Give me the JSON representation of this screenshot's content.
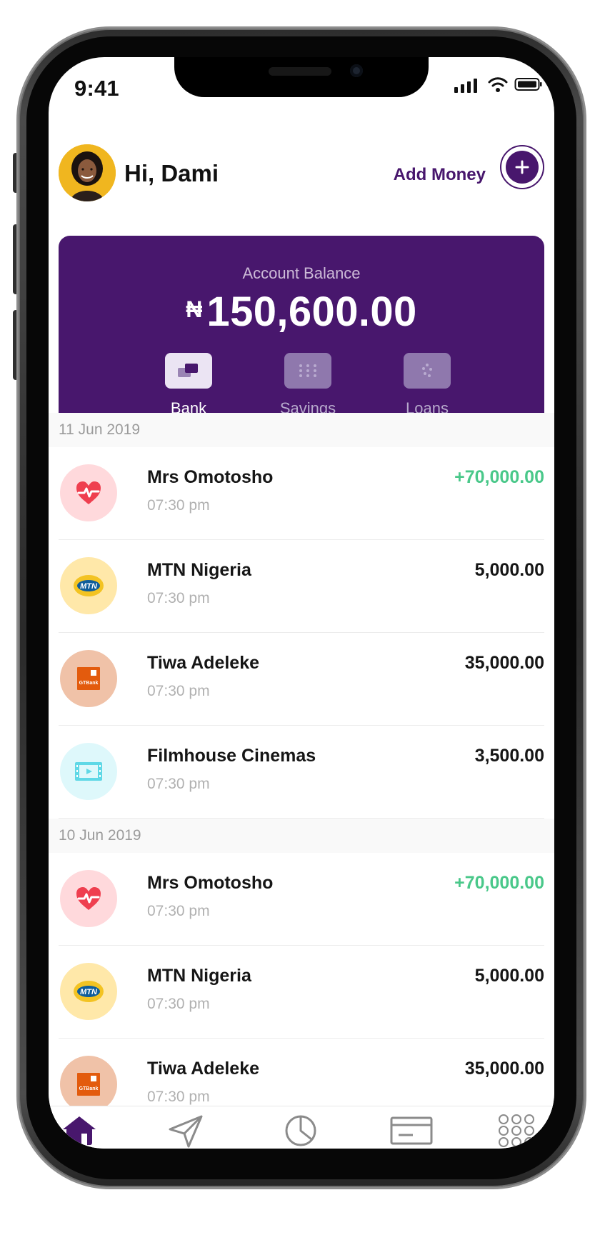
{
  "status_bar": {
    "time": "9:41"
  },
  "header": {
    "greeting": "Hi, Dami",
    "add_money_label": "Add Money"
  },
  "balance_card": {
    "label": "Account Balance",
    "currency": "₦",
    "amount": "150,600.00",
    "tabs": [
      {
        "label": "Bank",
        "icon": "bank-icon"
      },
      {
        "label": "Savings",
        "icon": "savings-icon"
      },
      {
        "label": "Loans",
        "icon": "loans-icon"
      }
    ]
  },
  "sections": [
    {
      "date": "11 Jun 2019",
      "transactions": [
        {
          "name": "Mrs Omotosho",
          "time": "07:30 pm",
          "amount": "+70,000.00",
          "icon": "heart-pulse-icon"
        },
        {
          "name": "MTN Nigeria",
          "time": "07:30 pm",
          "amount": "5,000.00",
          "icon": "mtn-logo-icon"
        },
        {
          "name": "Tiwa Adeleke",
          "time": "07:30 pm",
          "amount": "35,000.00",
          "icon": "gtbank-logo-icon"
        },
        {
          "name": "Filmhouse Cinemas",
          "time": "07:30 pm",
          "amount": "3,500.00",
          "icon": "film-icon"
        }
      ]
    },
    {
      "date": "10 Jun 2019",
      "transactions": [
        {
          "name": "Mrs Omotosho",
          "time": "07:30 pm",
          "amount": "+70,000.00",
          "icon": "heart-pulse-icon"
        },
        {
          "name": "MTN Nigeria",
          "time": "07:30 pm",
          "amount": "5,000.00",
          "icon": "mtn-logo-icon"
        },
        {
          "name": "Tiwa Adeleke",
          "time": "07:30 pm",
          "amount": "35,000.00",
          "icon": "gtbank-logo-icon"
        }
      ]
    }
  ],
  "brand_logos": {
    "mtn": "MTN",
    "gtbank": "GTBank"
  },
  "nav": [
    {
      "icon": "home-icon"
    },
    {
      "icon": "send-icon"
    },
    {
      "icon": "pie-chart-icon"
    },
    {
      "icon": "card-icon"
    },
    {
      "icon": "apps-grid-icon"
    }
  ],
  "colors": {
    "brand_purple": "#48176d",
    "positive_green": "#4ac88a",
    "date_gray": "#9b9b9b"
  }
}
